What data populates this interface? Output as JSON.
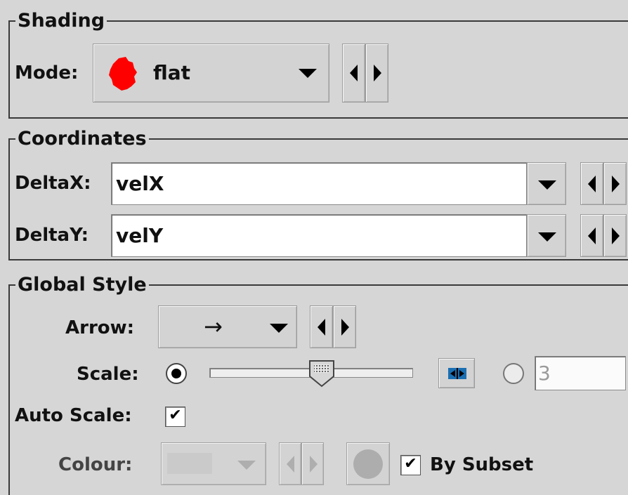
{
  "shading": {
    "title": "Shading",
    "mode_label": "Mode:",
    "mode_value": "flat",
    "mode_icon": "red-blob-icon",
    "mode_color": "#ff0000"
  },
  "coordinates": {
    "title": "Coordinates",
    "deltax_label": "DeltaX:",
    "deltax_value": "velX",
    "deltay_label": "DeltaY:",
    "deltay_value": "velY"
  },
  "global_style": {
    "title": "Global Style",
    "arrow_label": "Arrow:",
    "arrow_value": "→",
    "scale_label": "Scale:",
    "scale_fixed_value": "3",
    "slider_level": 0.55,
    "autoscale_label": "Auto Scale:",
    "autoscale_check": "✔",
    "colour_label": "Colour:",
    "by_subset_label": "By Subset",
    "by_subset_check": "✔"
  }
}
